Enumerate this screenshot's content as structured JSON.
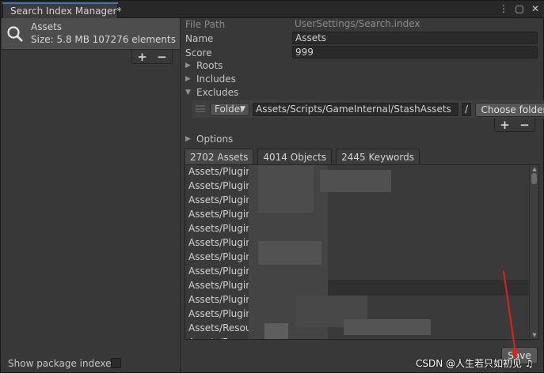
{
  "window": {
    "title": "Search Index Manager*",
    "accent_color": "#3a79bb",
    "buttons": [
      "more-icon",
      "maximize-icon",
      "close-icon"
    ],
    "more_glyph": "⋮",
    "max_glyph": "▢",
    "close_glyph": "✕"
  },
  "left": {
    "index": {
      "name": "Assets",
      "size": "Size: 5.8 MB",
      "elements": "107276 elements",
      "icon": "search-icon"
    },
    "plus": "+",
    "minus": "−",
    "show_package_label": "Show package indexes",
    "show_package_checked": false
  },
  "props": {
    "file_path_label": "File Path",
    "file_path_value": "UserSettings/Search.index",
    "name_label": "Name",
    "name_value": "Assets",
    "score_label": "Score",
    "score_value": "999"
  },
  "foldouts": {
    "roots": "Roots",
    "includes": "Includes",
    "excludes": "Excludes",
    "options": "Options"
  },
  "exclude": {
    "type": "Folder",
    "path": "Assets/Scripts/GameInternal/StashAssets",
    "slash": "/",
    "choose_folder": "Choose folder",
    "plus": "+",
    "minus": "−"
  },
  "result_tabs": [
    "2702 Assets",
    "4014 Objects",
    "2445 Keywords"
  ],
  "results": [
    "Assets/Plugins/",
    "Assets/Plugins/",
    "Assets/Plugins/",
    "Assets/Plugins/",
    "Assets/Plugins/",
    "Assets/Plugins/",
    "Assets/Plugins/",
    "Assets/Plugins/",
    "Assets/Plugins/",
    "Assets/Plugins/",
    "Assets/Plugins",
    "Assets/Resour",
    "Assets/Resources/Local..."
  ],
  "save_label": "Save",
  "watermark": "CSDN @人生若只如初见 ♫"
}
